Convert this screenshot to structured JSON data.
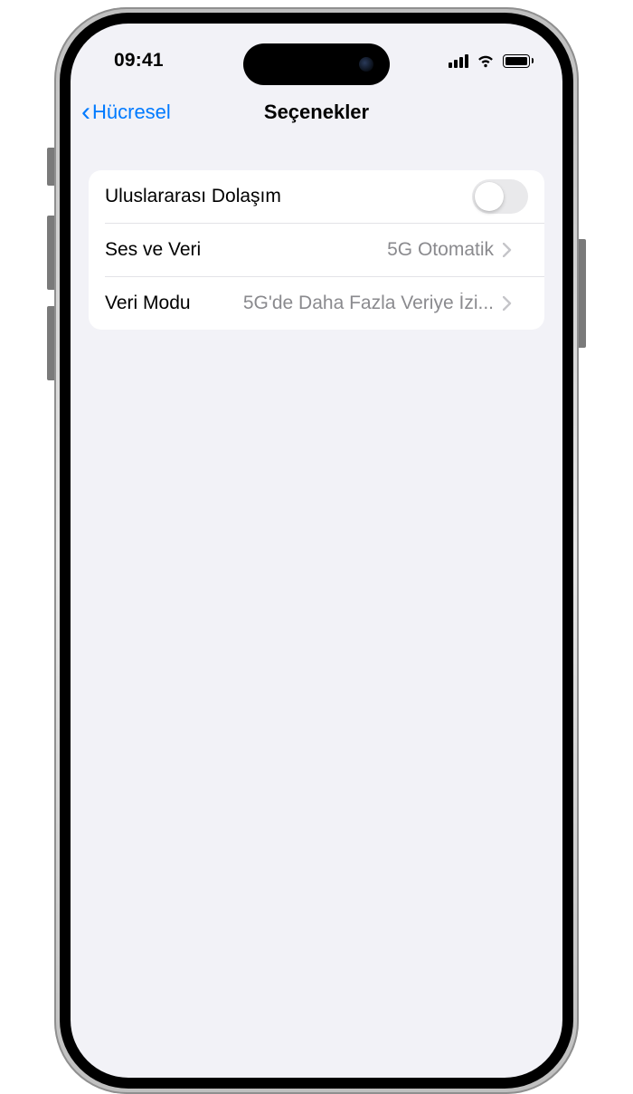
{
  "status": {
    "time": "09:41"
  },
  "nav": {
    "back_label": "Hücresel",
    "title": "Seçenekler"
  },
  "rows": {
    "roaming": {
      "label": "Uluslararası Dolaşım",
      "on": false
    },
    "voice_data": {
      "label": "Ses ve Veri",
      "value": "5G Otomatik"
    },
    "data_mode": {
      "label": "Veri Modu",
      "value": "5G'de Daha Fazla Veriye İzi..."
    }
  }
}
